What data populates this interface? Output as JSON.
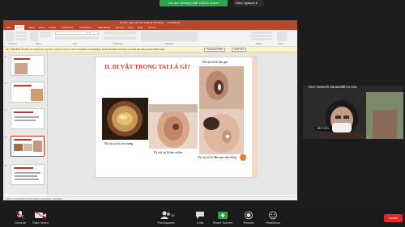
{
  "banner": {
    "sharing_text": "You are viewing CẨP CỬU's screen",
    "view_options": "View Options ▾"
  },
  "ppt": {
    "title": "B.3.3C. Siêu vẻn các dị vật tai mũi họng ... - PowerPoint",
    "tabs": [
      "File",
      "Home",
      "Insert",
      "Draw",
      "Design",
      "Transitions",
      "Animations",
      "Slide Show",
      "Review",
      "View",
      "Help",
      "Tell me"
    ],
    "ribbon_groups": [
      "Clipboard",
      "Slides",
      "Font",
      "Paragraph",
      "Drawing",
      "Editing",
      "Voice"
    ],
    "warning": "GET GENUINE OFFICE  Your license isn't genuine, and you may be a victim of software counterfeiting. Avoid interruption and keep your files safe with genuine Office today.",
    "warn_btn1": "Get genuine Office",
    "warn_btn2": "Learn more",
    "notes": "Click to add notes",
    "status": "Slide 5 of 33    English (United States)    Accessibility: Investigate"
  },
  "slide": {
    "title": "II.   DỊ VẬT TRONG TAI LÀ GÌ?",
    "cap_top": "Dị vật tai là hạt gạo",
    "cap_left": "Dị vật tai là côn trùng",
    "cap_mid": "Dị vật tai là hạt cườm",
    "cap_bottom": "Dị vật tai là đầu que tăm bông"
  },
  "thumbs": [
    "2",
    "3",
    "4",
    "5",
    "6"
  ],
  "video": {
    "bandwidth": "Your network bandwidth is low.",
    "name": "CẨP CỬU"
  },
  "toolbar": {
    "unmute": "Unmute",
    "start_video": "Start Video",
    "participants": "Participants",
    "participants_count": "28",
    "chat": "Chat",
    "share_screen": "Share Screen",
    "record": "Record",
    "reactions": "Reactions",
    "leave": "Leave"
  },
  "colors": {
    "ppt_accent": "#b7472a",
    "slide_title": "#c0392b",
    "share_green": "#2fa34c",
    "leave_red": "#e02828"
  }
}
